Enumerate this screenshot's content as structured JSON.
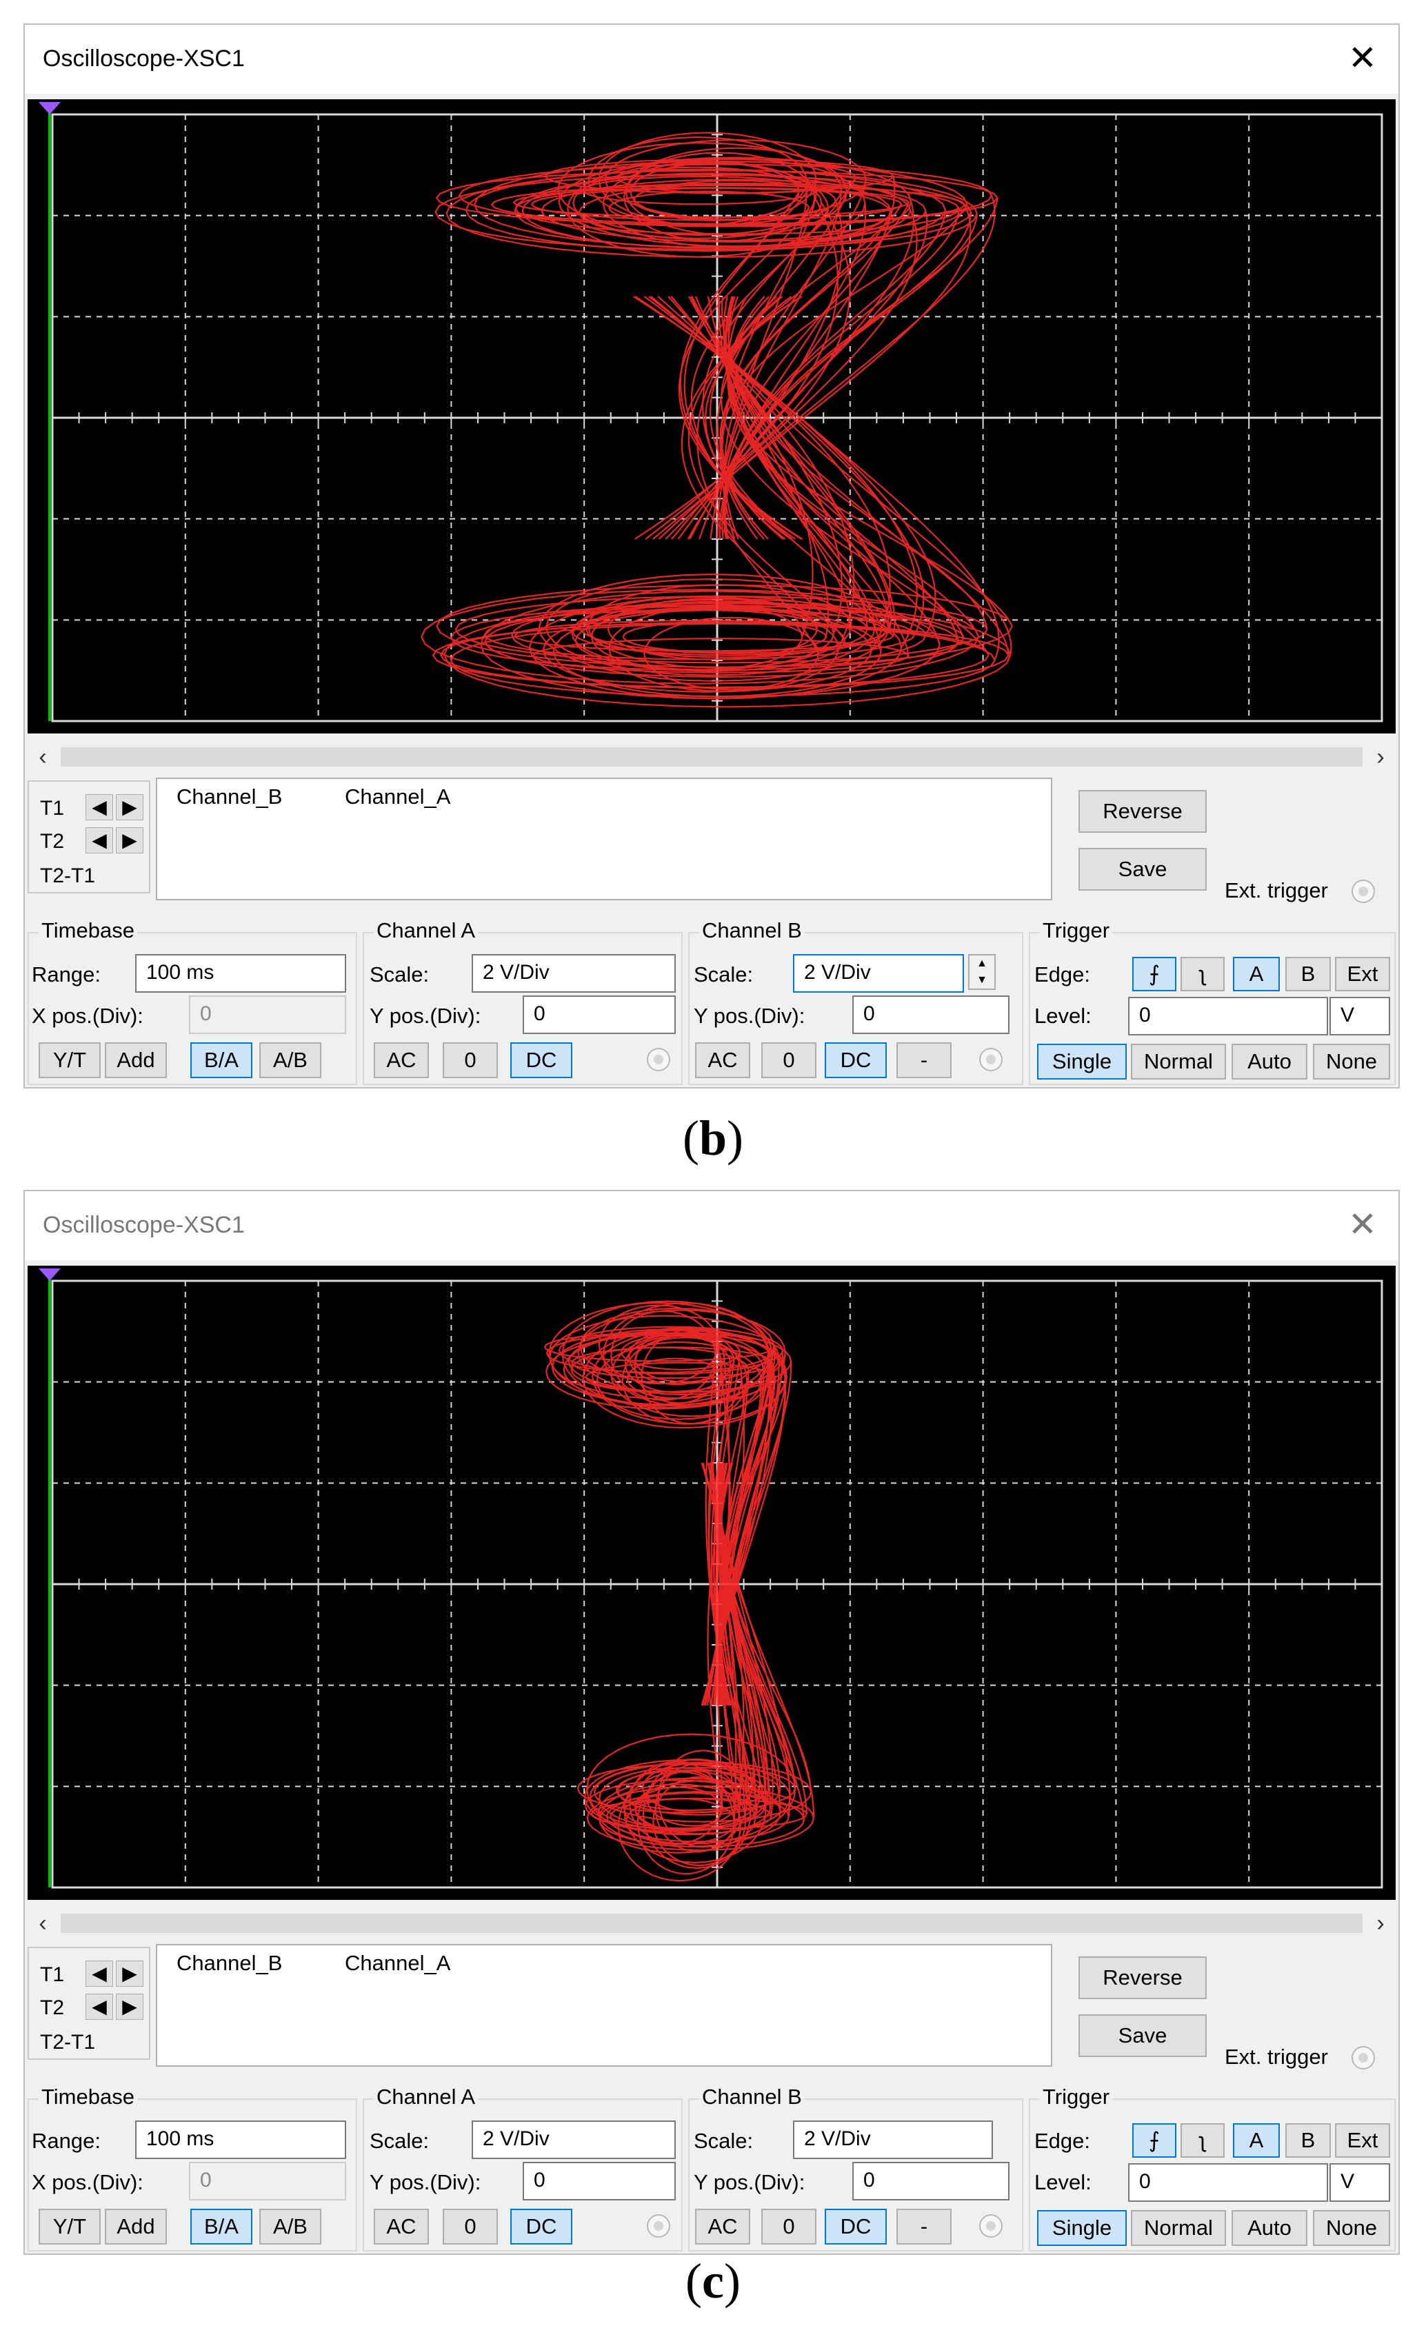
{
  "panels": [
    {
      "title": "Oscilloscope-XSC1",
      "caption": "b",
      "readout": {
        "col1": "Channel_B",
        "col2": "Channel_A"
      },
      "cursor": {
        "t1": "T1",
        "t2": "T2",
        "t2t1": "T2-T1"
      },
      "buttons": {
        "reverse": "Reverse",
        "save": "Save",
        "ext_trigger": "Ext. trigger"
      },
      "timebase": {
        "title": "Timebase",
        "range_label": "Range:",
        "range": "100 ms",
        "xpos_label": "X pos.(Div):",
        "xpos": "0",
        "modes": [
          "Y/T",
          "Add",
          "B/A",
          "A/B"
        ],
        "selected_mode": "B/A"
      },
      "channel_a": {
        "title": "Channel A",
        "scale_label": "Scale:",
        "scale": "2  V/Div",
        "ypos_label": "Y pos.(Div):",
        "ypos": "0",
        "coupling": [
          "AC",
          "0",
          "DC"
        ],
        "selected": "DC"
      },
      "channel_b": {
        "title": "Channel B",
        "scale_label": "Scale:",
        "scale": "2  V/Div",
        "ypos_label": "Y pos.(Div):",
        "ypos": "0",
        "coupling": [
          "AC",
          "0",
          "DC",
          "-"
        ],
        "selected": "DC"
      },
      "trigger": {
        "title": "Trigger",
        "edge_label": "Edge:",
        "level_label": "Level:",
        "level": "0",
        "unit": "V",
        "sources": [
          "A",
          "B",
          "Ext"
        ],
        "selected_source": "A",
        "modes": [
          "Single",
          "Normal",
          "Auto",
          "None"
        ],
        "selected_mode": "Single"
      }
    },
    {
      "title": "Oscilloscope-XSC1",
      "caption": "c",
      "readout": {
        "col1": "Channel_B",
        "col2": "Channel_A"
      },
      "cursor": {
        "t1": "T1",
        "t2": "T2",
        "t2t1": "T2-T1"
      },
      "buttons": {
        "reverse": "Reverse",
        "save": "Save",
        "ext_trigger": "Ext. trigger"
      },
      "timebase": {
        "title": "Timebase",
        "range_label": "Range:",
        "range": "100 ms",
        "xpos_label": "X pos.(Div):",
        "xpos": "0",
        "modes": [
          "Y/T",
          "Add",
          "B/A",
          "A/B"
        ],
        "selected_mode": "B/A"
      },
      "channel_a": {
        "title": "Channel A",
        "scale_label": "Scale:",
        "scale": "2  V/Div",
        "ypos_label": "Y pos.(Div):",
        "ypos": "0",
        "coupling": [
          "AC",
          "0",
          "DC"
        ],
        "selected": "DC"
      },
      "channel_b": {
        "title": "Channel B",
        "scale_label": "Scale:",
        "scale": "2  V/Div",
        "ypos_label": "Y pos.(Div):",
        "ypos": "0",
        "coupling": [
          "AC",
          "0",
          "DC",
          "-"
        ],
        "selected": "DC"
      },
      "trigger": {
        "title": "Trigger",
        "edge_label": "Edge:",
        "level_label": "Level:",
        "level": "0",
        "unit": "V",
        "sources": [
          "A",
          "B",
          "Ext"
        ],
        "selected_source": "A",
        "modes": [
          "Single",
          "Normal",
          "Auto",
          "None"
        ],
        "selected_mode": "Single"
      }
    }
  ],
  "colors": {
    "trace": "#ff2a2a",
    "grid": "#d9d9d9",
    "screen": "#000000",
    "cursor_line": "#00c000"
  },
  "icons": {
    "close": "close-icon",
    "arrows": [
      "arrow-left-icon",
      "arrow-right-icon"
    ],
    "edges": [
      "rising-edge-icon",
      "falling-edge-icon"
    ]
  }
}
